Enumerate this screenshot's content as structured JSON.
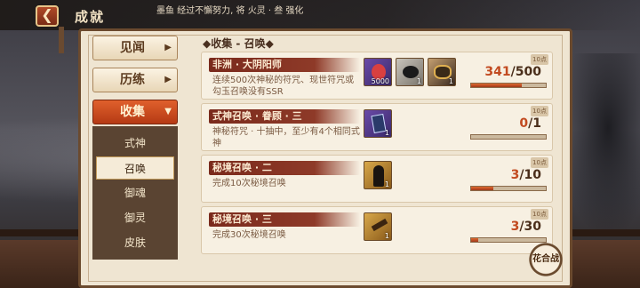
{
  "header": {
    "title": "成就",
    "back_icon": "back-arrow-icon",
    "ticker": "墨鱼 经过不懈努力, 将 火灵 · 叁 强化"
  },
  "sidebar": {
    "categories": [
      {
        "label": "见闻",
        "active": false
      },
      {
        "label": "历练",
        "active": false
      },
      {
        "label": "收集",
        "active": true
      }
    ],
    "subitems": [
      {
        "label": "式神",
        "active": false
      },
      {
        "label": "召唤",
        "active": true
      },
      {
        "label": "御魂",
        "active": false
      },
      {
        "label": "御灵",
        "active": false
      },
      {
        "label": "皮肤",
        "active": false
      }
    ]
  },
  "section": {
    "title": "◆收集 - 召唤◆"
  },
  "items": [
    {
      "name": "非洲 · 大阴阳师",
      "desc": "连续500次神秘的符咒、现世符咒或勾玉召唤没有SSR",
      "rewards": [
        {
          "icon": "red-gem-icon",
          "qty": "5000"
        },
        {
          "icon": "mask-icon",
          "qty": "1"
        },
        {
          "icon": "gold-mask-icon",
          "qty": "1"
        }
      ],
      "badge": "10点",
      "progress_current": "341",
      "progress_total": "/500",
      "progress_fraction": 0.68
    },
    {
      "name": "式神召唤 · 眷顾 · 三",
      "desc": "神秘符咒 · 十抽中，至少有4个相同式神",
      "rewards": [
        {
          "icon": "card-icon",
          "qty": "1"
        }
      ],
      "badge": "10点",
      "progress_current": "0",
      "progress_total": "/1",
      "progress_fraction": 0.0
    },
    {
      "name": "秘境召唤 · 二",
      "desc": "完成10次秘境召唤",
      "rewards": [
        {
          "icon": "shikigami-figure-icon",
          "qty": "1"
        }
      ],
      "badge": "10点",
      "progress_current": "3",
      "progress_total": "/10",
      "progress_fraction": 0.3
    },
    {
      "name": "秘境召唤 · 三",
      "desc": "完成30次秘境召唤",
      "rewards": [
        {
          "icon": "bell-item-icon",
          "qty": "1"
        }
      ],
      "badge": "10点",
      "progress_current": "3",
      "progress_total": "/30",
      "progress_fraction": 0.1
    }
  ],
  "seal": {
    "label": "花合战"
  }
}
